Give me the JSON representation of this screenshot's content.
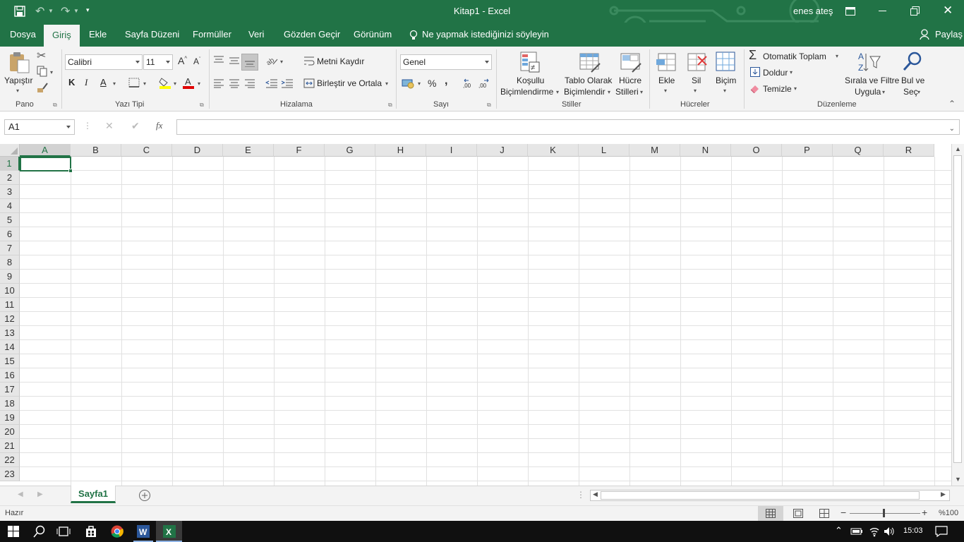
{
  "window": {
    "title": "Kitap1  -  Excel",
    "user": "enes ateş"
  },
  "tabs": [
    "Dosya",
    "Giriş",
    "Ekle",
    "Sayfa Düzeni",
    "Formüller",
    "Veri",
    "Gözden Geçir",
    "Görünüm"
  ],
  "tell_me": "Ne yapmak istediğinizi söyleyin",
  "share": "Paylaş",
  "ribbon": {
    "clipboard": {
      "paste": "Yapıştır",
      "group": "Pano"
    },
    "font": {
      "name": "Calibri",
      "size": "11",
      "bold": "K",
      "italic": "I",
      "underline": "A",
      "group": "Yazı Tipi"
    },
    "alignment": {
      "wrap": "Metni Kaydır",
      "merge": "Birleştir ve Ortala",
      "group": "Hizalama"
    },
    "number": {
      "format": "Genel",
      "percent": "%",
      "comma": ",",
      "group": "Sayı"
    },
    "styles": {
      "conditional1": "Koşullu",
      "conditional2": "Biçimlendirme",
      "table1": "Tablo Olarak",
      "table2": "Biçimlendir",
      "cell1": "Hücre",
      "cell2": "Stilleri",
      "group": "Stiller"
    },
    "cells": {
      "insert": "Ekle",
      "delete": "Sil",
      "format": "Biçim",
      "group": "Hücreler"
    },
    "editing": {
      "autosum": "Otomatik Toplam",
      "fill": "Doldur",
      "clear": "Temizle",
      "sort1": "Sırala ve Filtre",
      "sort2": "Uygula",
      "find1": "Bul ve",
      "find2": "Seç",
      "group": "Düzenleme"
    }
  },
  "formula_bar": {
    "name_box": "A1",
    "fx": "fx",
    "value": ""
  },
  "grid": {
    "columns": [
      "A",
      "B",
      "C",
      "D",
      "E",
      "F",
      "G",
      "H",
      "I",
      "J",
      "K",
      "L",
      "M",
      "N",
      "O",
      "P",
      "Q",
      "R"
    ],
    "rows": [
      "1",
      "2",
      "3",
      "4",
      "5",
      "6",
      "7",
      "8",
      "9",
      "10",
      "11",
      "12",
      "13",
      "14",
      "15",
      "16",
      "17",
      "18",
      "19",
      "20",
      "21",
      "22",
      "23"
    ],
    "selected": "A1"
  },
  "sheets": [
    "Sayfa1"
  ],
  "status": {
    "ready": "Hazır",
    "zoom": "%100"
  },
  "taskbar": {
    "time": "15:03"
  },
  "colors": {
    "accent": "#217346",
    "ribbon_bg": "#f3f3f3",
    "grid_line": "#e1e1e1"
  }
}
